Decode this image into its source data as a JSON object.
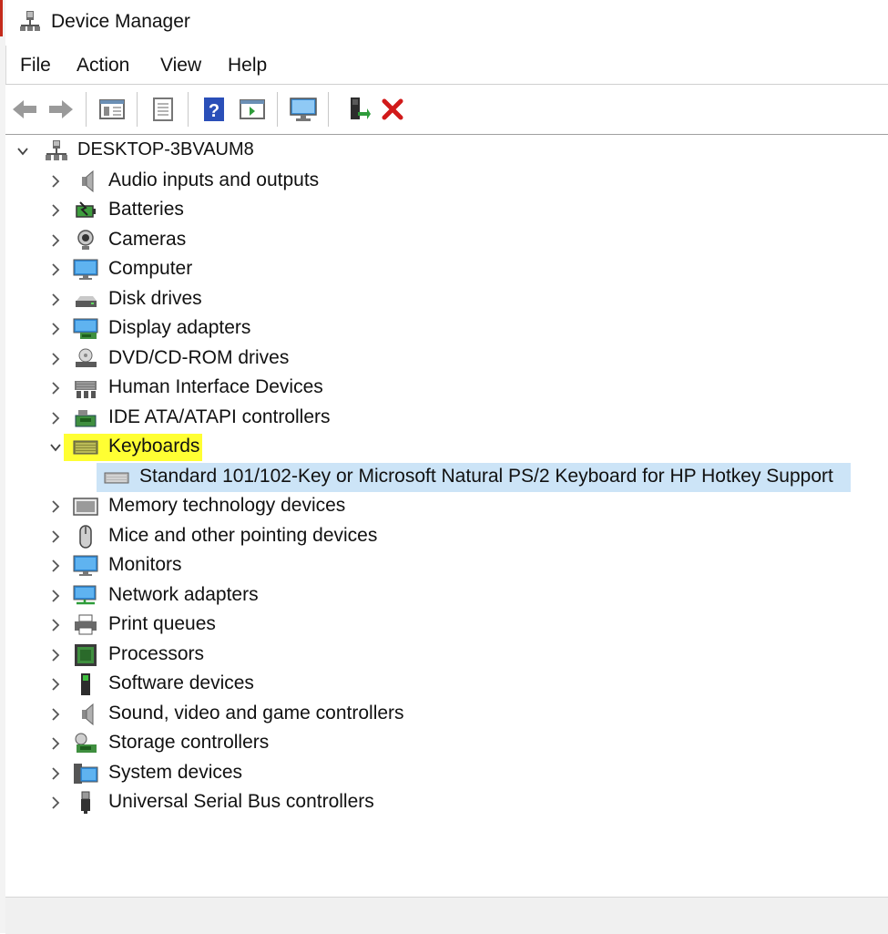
{
  "window": {
    "title": "Device Manager"
  },
  "menu": [
    "File",
    "Action",
    "View",
    "Help"
  ],
  "toolbar": {
    "buttons": [
      "back-arrow-icon",
      "forward-arrow-icon",
      "show-hide-console-tree-icon",
      "properties-icon",
      "help-icon",
      "action-pane-icon",
      "monitor-scan-icon",
      "update-driver-icon",
      "uninstall-device-icon"
    ]
  },
  "tree": {
    "root": "DESKTOP-3BVAUM8",
    "categories": [
      "Audio inputs and outputs",
      "Batteries",
      "Cameras",
      "Computer",
      "Disk drives",
      "Display adapters",
      "DVD/CD-ROM drives",
      "Human Interface Devices",
      "IDE ATA/ATAPI controllers",
      "Keyboards",
      "Memory technology devices",
      "Mice and other pointing devices",
      "Monitors",
      "Network adapters",
      "Print queues",
      "Processors",
      "Software devices",
      "Sound, video and game controllers",
      "Storage controllers",
      "System devices",
      "Universal Serial Bus controllers"
    ],
    "keyboard_child": "Standard 101/102-Key or Microsoft Natural PS/2 Keyboard for HP Hotkey Support"
  },
  "colors": {
    "highlight": "#ffff33",
    "selection": "#cce4f7",
    "uninstall_red": "#d11a1a"
  }
}
